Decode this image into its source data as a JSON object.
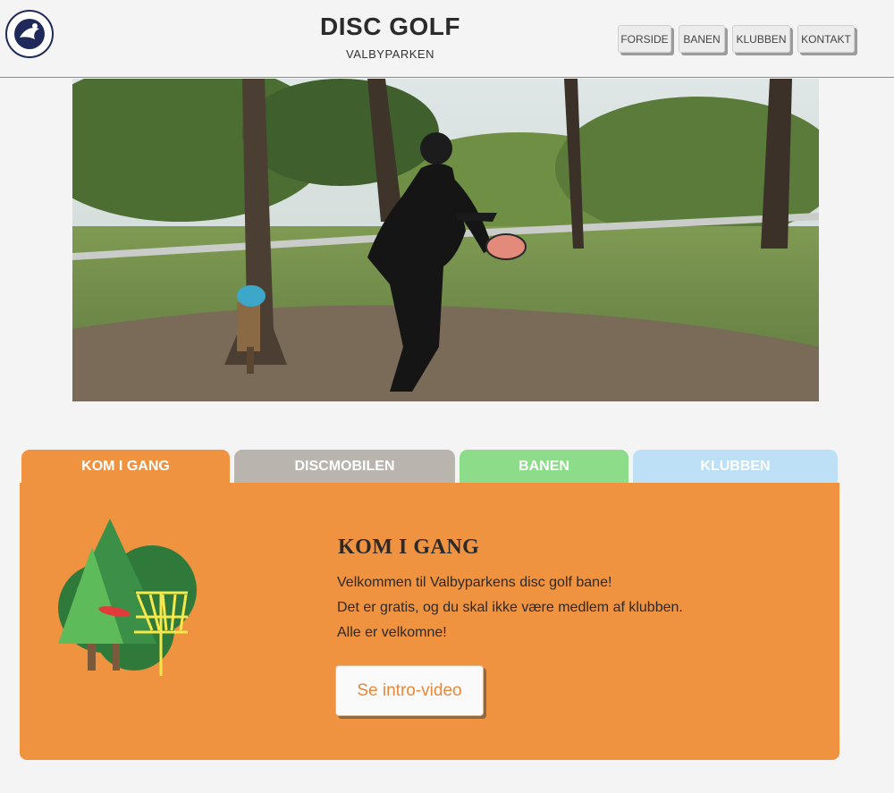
{
  "header": {
    "title": "DISC GOLF",
    "subtitle": "VALBYPARKEN",
    "logo_icon": "club-logo-icon"
  },
  "nav": {
    "items": [
      {
        "label": "FORSIDE"
      },
      {
        "label": "BANEN"
      },
      {
        "label": "KLUBBEN"
      },
      {
        "label": "KONTAKT"
      }
    ]
  },
  "tabs": [
    {
      "label": "KOM I GANG",
      "color": "#f09340"
    },
    {
      "label": "DISCMOBILEN",
      "color": "#b9b4ad"
    },
    {
      "label": "BANEN",
      "color": "#8cdc8a"
    },
    {
      "label": "KLUBBEN",
      "color": "#bde0f6"
    }
  ],
  "panel": {
    "title": "KOM I GANG",
    "lines": [
      "Velkommen til Valbyparkens disc golf bane!",
      "Det er gratis, og du skal ikke være medlem af klubben.",
      "Alle er velkomne!"
    ],
    "button_label": "Se intro-video"
  },
  "colors": {
    "accent_orange": "#f09340",
    "button_text": "#e8883a"
  }
}
